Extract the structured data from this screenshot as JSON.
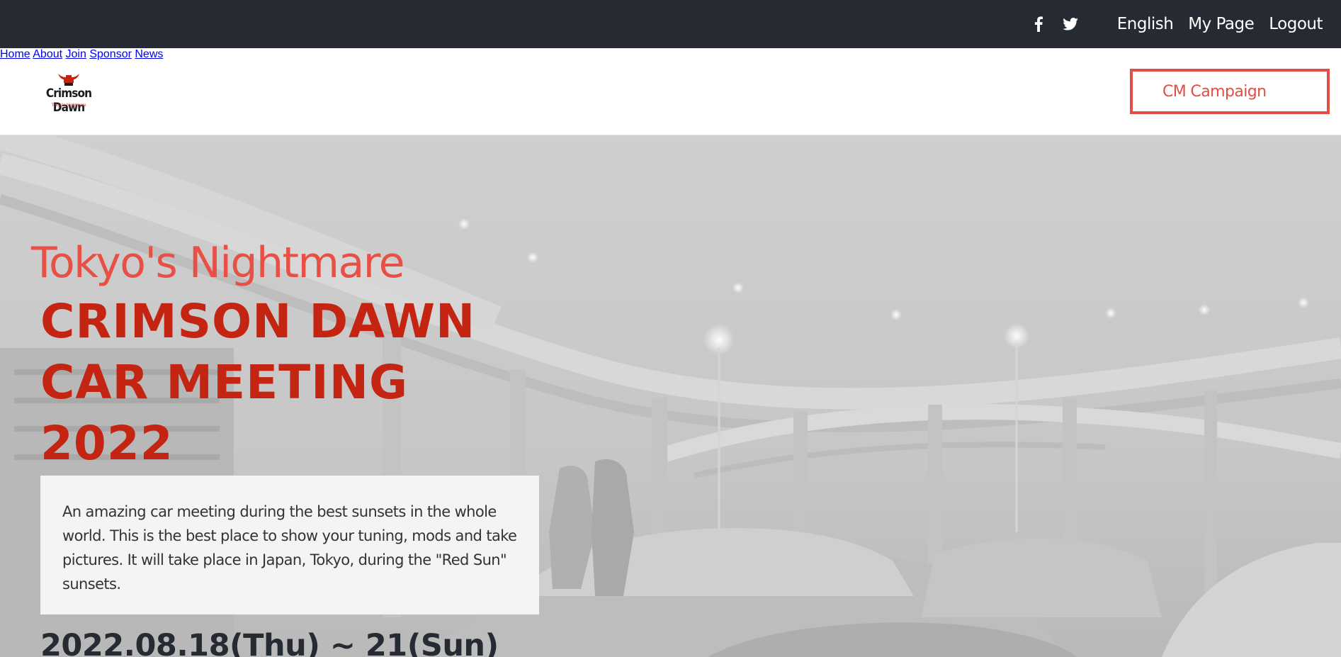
{
  "topbar": {
    "social": [
      {
        "icon": "facebook-icon"
      },
      {
        "icon": "twitter-icon"
      }
    ],
    "links": [
      "English",
      "My Page",
      "Logout"
    ]
  },
  "header": {
    "logo": {
      "brand": "Crimson Dawn",
      "subtitle": "Tokyo's Nightmare",
      "icon": "samurai-helmet-icon"
    },
    "nav": [
      "Home",
      "About",
      "Join",
      "Sponsor",
      "News"
    ],
    "cta_label": "CM Campaign"
  },
  "hero": {
    "tagline": "Tokyo's Nightmare",
    "title_lines": [
      "CRIMSON DAWN",
      "CAR MEETING",
      "2022"
    ],
    "description": "An amazing car meeting during the best sunsets in the whole world. This is the best place to show your tuning, mods and take pictures. It will take place in Japan, Tokyo, during the \"Red Sun\" sunsets.",
    "dates": "2022.08.18(Thu) ~ 21(Sun)"
  },
  "colors": {
    "topbar_bg": "#262a33",
    "accent_red": "#e04e45",
    "title_red": "#c42512"
  }
}
